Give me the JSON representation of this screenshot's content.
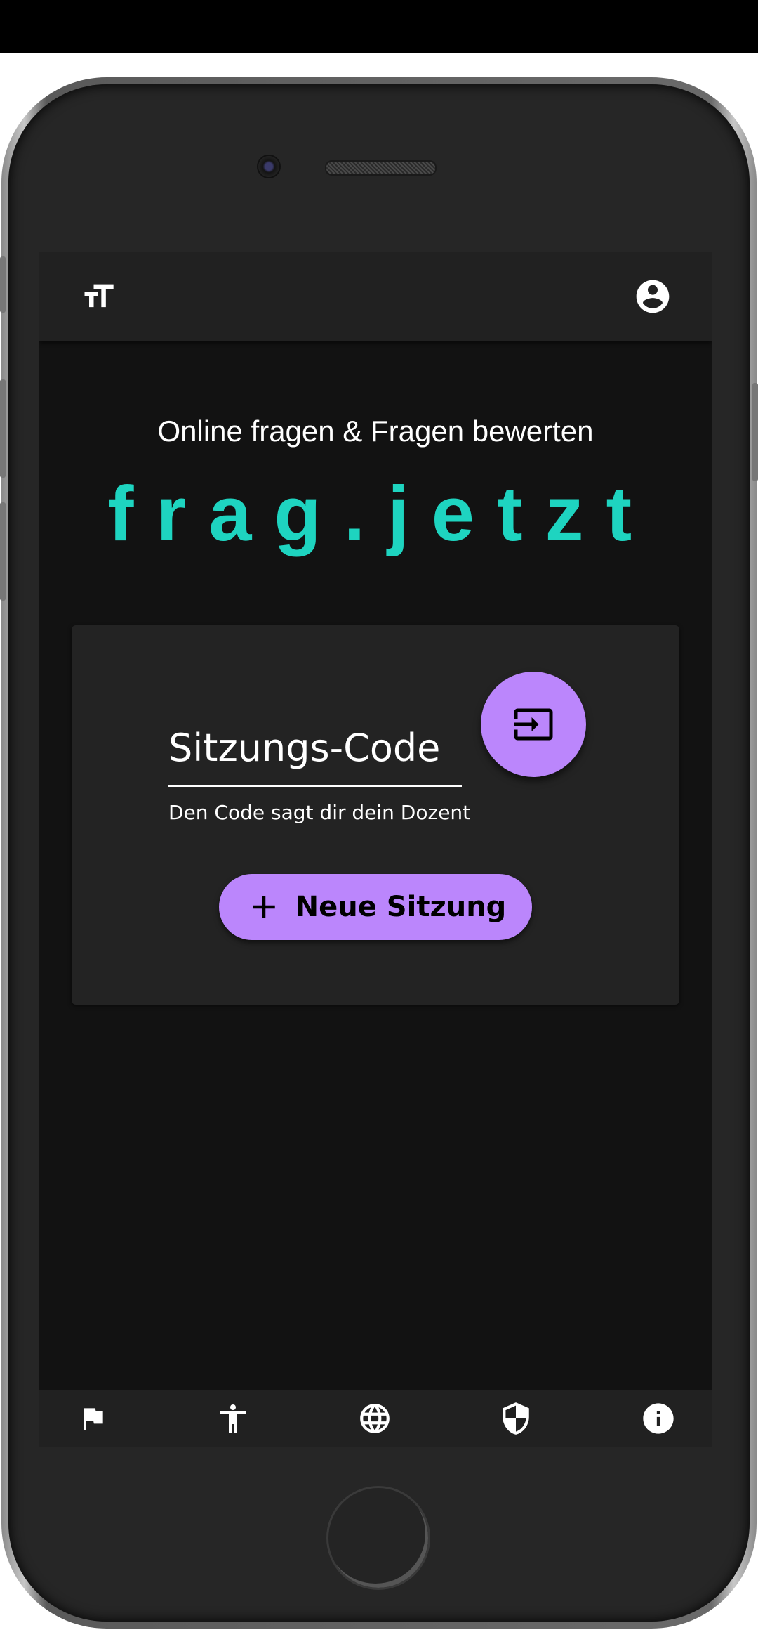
{
  "header": {
    "font_size_icon": "text-size-icon",
    "account_icon": "account-circle-icon"
  },
  "home": {
    "subtitle": "Online fragen & Fragen bewerten",
    "brand": "frag.jetzt"
  },
  "join_card": {
    "session_code_placeholder": "Sitzungs-Code",
    "session_code_value": "",
    "hint": "Den Code sagt dir dein Dozent",
    "enter_icon": "input-enter-icon",
    "new_session_label": "Neue Sitzung",
    "new_session_icon": "plus-icon"
  },
  "bottom_nav": {
    "items": [
      {
        "icon": "flag-icon"
      },
      {
        "icon": "accessibility-icon"
      },
      {
        "icon": "globe-icon"
      },
      {
        "icon": "shield-icon"
      },
      {
        "icon": "info-icon"
      }
    ]
  },
  "colors": {
    "accent": "#bb86fc",
    "brand": "#1ed4c0",
    "background": "#121212",
    "surface": "#232323"
  }
}
